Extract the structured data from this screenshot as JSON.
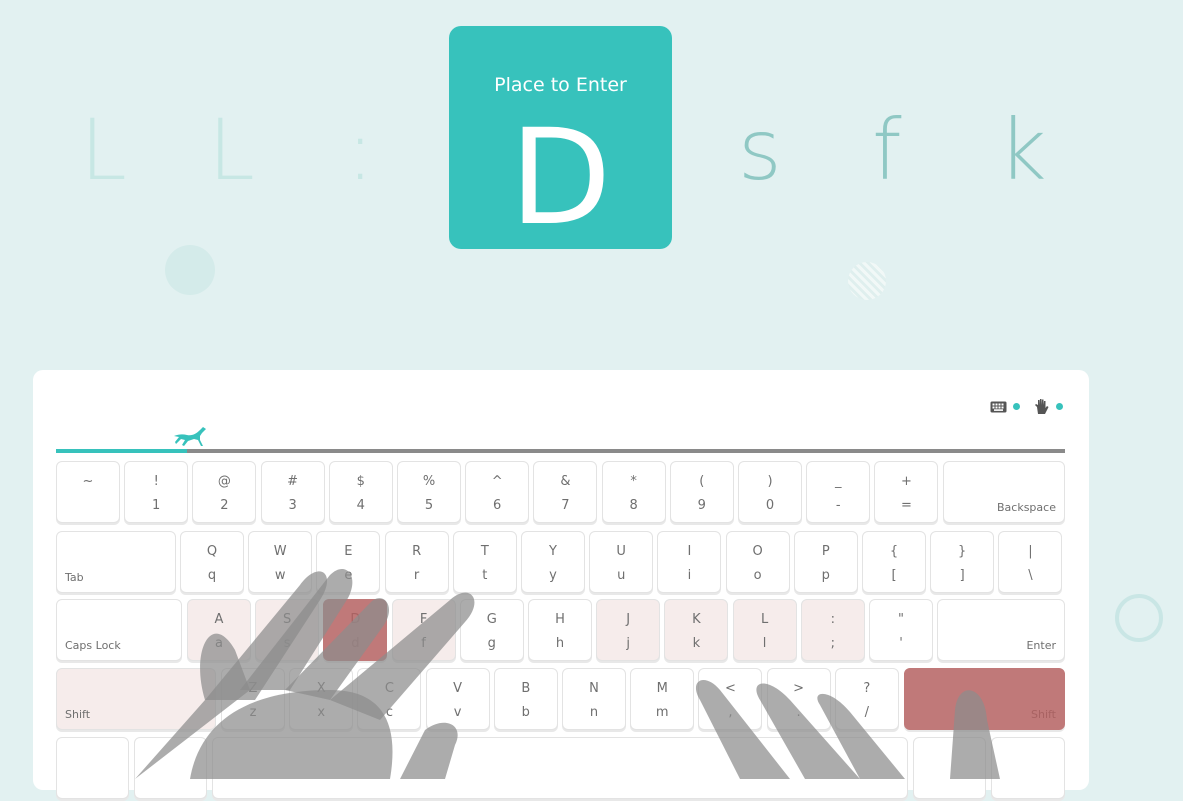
{
  "prompt": {
    "caption": "Place to Enter",
    "current": "D",
    "previous": [
      "L",
      "L",
      ":"
    ],
    "upcoming": [
      "s",
      "f",
      "k"
    ]
  },
  "progress": {
    "fraction": 0.13
  },
  "toggles": [
    {
      "icon": "keyboard-icon",
      "enabled": true
    },
    {
      "icon": "hand-icon",
      "enabled": true
    }
  ],
  "colors": {
    "accent": "#37c2bc",
    "active_key": "#c07979",
    "hint_key": "#f6eceb",
    "background": "#e2f1f1"
  },
  "keyboard": {
    "row1": [
      {
        "u": "~",
        "l": ""
      },
      {
        "u": "!",
        "l": "1"
      },
      {
        "u": "@",
        "l": "2"
      },
      {
        "u": "#",
        "l": "3"
      },
      {
        "u": "$",
        "l": "4"
      },
      {
        "u": "%",
        "l": "5"
      },
      {
        "u": "^",
        "l": "6"
      },
      {
        "u": "&",
        "l": "7"
      },
      {
        "u": "*",
        "l": "8"
      },
      {
        "u": "(",
        "l": "9"
      },
      {
        "u": ")",
        "l": "0"
      },
      {
        "u": "_",
        "l": "-"
      },
      {
        "u": "+",
        "l": "="
      }
    ],
    "backspace": "Backspace",
    "tab": "Tab",
    "row2": [
      {
        "u": "Q",
        "l": "q"
      },
      {
        "u": "W",
        "l": "w"
      },
      {
        "u": "E",
        "l": "e"
      },
      {
        "u": "R",
        "l": "r"
      },
      {
        "u": "T",
        "l": "t"
      },
      {
        "u": "Y",
        "l": "y"
      },
      {
        "u": "U",
        "l": "u"
      },
      {
        "u": "I",
        "l": "i"
      },
      {
        "u": "O",
        "l": "o"
      },
      {
        "u": "P",
        "l": "p"
      },
      {
        "u": "{",
        "l": "["
      },
      {
        "u": "}",
        "l": "]"
      },
      {
        "u": "|",
        "l": "\\"
      }
    ],
    "capslock": "Caps Lock",
    "row3": [
      {
        "u": "A",
        "l": "a",
        "state": "hint"
      },
      {
        "u": "S",
        "l": "s",
        "state": "hint"
      },
      {
        "u": "D",
        "l": "d",
        "state": "active"
      },
      {
        "u": "F",
        "l": "f",
        "state": "hint"
      },
      {
        "u": "G",
        "l": "g"
      },
      {
        "u": "H",
        "l": "h"
      },
      {
        "u": "J",
        "l": "j",
        "state": "hint"
      },
      {
        "u": "K",
        "l": "k",
        "state": "hint"
      },
      {
        "u": "L",
        "l": "l",
        "state": "hint"
      },
      {
        "u": ":",
        "l": ";",
        "state": "hint"
      },
      {
        "u": "\"",
        "l": "'"
      }
    ],
    "enter": "Enter",
    "shift_left": "Shift",
    "row4": [
      {
        "u": "Z",
        "l": "z"
      },
      {
        "u": "X",
        "l": "x"
      },
      {
        "u": "C",
        "l": "c"
      },
      {
        "u": "V",
        "l": "v"
      },
      {
        "u": "B",
        "l": "b"
      },
      {
        "u": "N",
        "l": "n"
      },
      {
        "u": "M",
        "l": "m"
      },
      {
        "u": "<",
        "l": ","
      },
      {
        "u": ">",
        "l": "."
      },
      {
        "u": "?",
        "l": "/"
      }
    ],
    "shift_right": "Shift"
  }
}
